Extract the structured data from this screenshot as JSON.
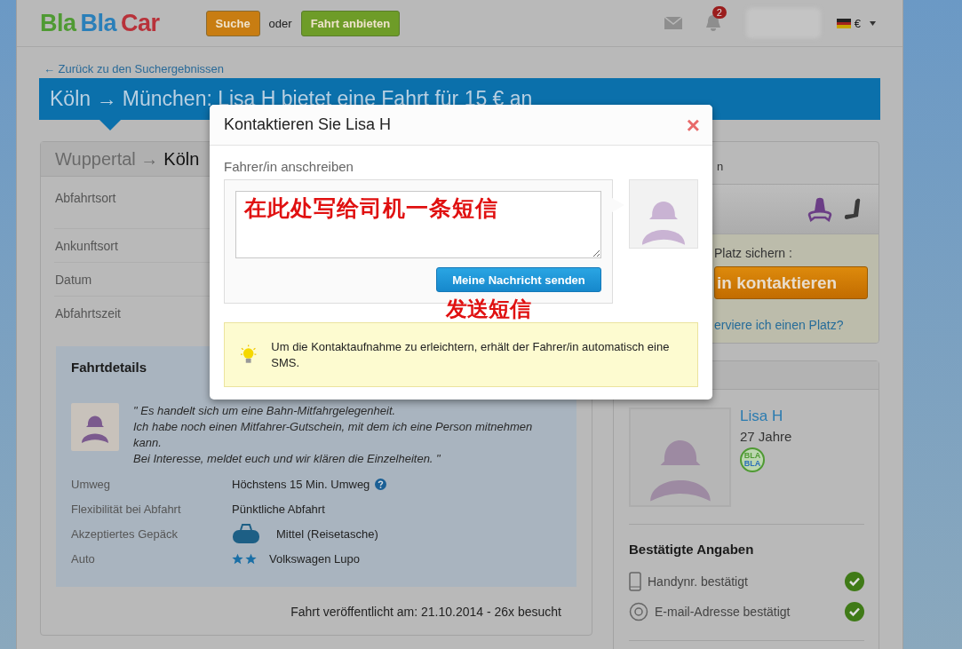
{
  "header": {
    "logo": [
      {
        "text": "Bla",
        "color": "#4f9a33"
      },
      {
        "text": "Bla",
        "color": "#2a7fb9"
      },
      {
        "text": "Car",
        "color": "#b8323a"
      }
    ],
    "search_button": "Suche",
    "or_text": "oder",
    "offer_button": "Fahrt anbieten",
    "notification_count": "2",
    "currency": "€"
  },
  "back_link": "← Zurück zu den Suchergebnissen",
  "title": "Köln → München: Lisa H bietet eine Fahrt für 15 € an",
  "route_card": {
    "route_from": "Wuppertal →",
    "route_to": "Köln",
    "fields": [
      "Abfahrtsort",
      "Ankunftsort",
      "Datum",
      "Abfahrtszeit"
    ]
  },
  "details": {
    "title": "Fahrtdetails",
    "quote": [
      "\" Es handelt sich um eine Bahn-Mitfahrgelegenheit.",
      "Ich habe noch einen Mitfahrer-Gutschein, mit dem ich eine Person mitnehmen kann.",
      "Bei Interesse, meldet euch und wir klären die Einzelheiten. \""
    ],
    "rows": [
      {
        "label": "Umweg",
        "value": "Höchstens 15 Min. Umweg",
        "kind": "help"
      },
      {
        "label": "Flexibilität bei Abfahrt",
        "value": "Pünktliche Abfahrt",
        "kind": "plain"
      },
      {
        "label": "Akzeptiertes Gepäck",
        "value": "Mittel (Reisetasche)",
        "kind": "luggage"
      },
      {
        "label": "Auto",
        "value": "Volkswagen Lupo",
        "kind": "comfort",
        "stars": 2
      }
    ]
  },
  "footer_text": "Fahrt veröffentlicht am: 21.10.2014 - 26x besucht",
  "booking_card": {
    "cut_text": "n",
    "reserve_prompt": "Platz sichern :",
    "contact_button": "in kontaktieren",
    "how_link": "erviere ich einen Platz?"
  },
  "driver_card": {
    "name": "Lisa H",
    "age": "27 Jahre",
    "badge": [
      "BLA",
      "BLA"
    ],
    "verified_title": "Bestätigte Angaben",
    "verifications": [
      {
        "kind": "phone",
        "label": "Handynr. bestätigt",
        "checked": true
      },
      {
        "kind": "email",
        "label": "E-mail-Adresse bestätigt",
        "checked": true
      }
    ]
  },
  "modal": {
    "title": "Kontaktieren Sie Lisa H",
    "close": "×",
    "label": "Fahrer/in anschreiben",
    "send_button": "Meine Nachricht senden",
    "info": "Um die Kontaktaufnahme zu erleichtern, erhält der Fahrer/in automatisch eine SMS.",
    "annotations": [
      {
        "kind": "field",
        "text": "在此处写给司机一条短信"
      },
      {
        "kind": "button",
        "text": "发送短信"
      }
    ]
  }
}
